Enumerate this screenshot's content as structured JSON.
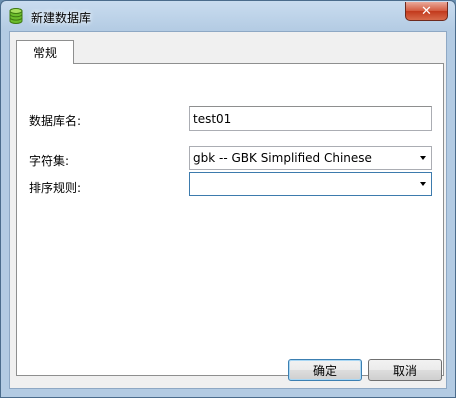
{
  "window": {
    "title": "新建数据库",
    "close_label": "✕"
  },
  "tabs": [
    {
      "label": "常规"
    }
  ],
  "form": {
    "db_name_label": "数据库名:",
    "db_name_value": "test01",
    "charset_label": "字符集:",
    "charset_value": "gbk -- GBK Simplified Chinese",
    "collation_label": "排序规则:",
    "collation_value": ""
  },
  "buttons": {
    "ok": "确定",
    "cancel": "取消"
  },
  "icons": {
    "app": "database-icon",
    "close": "close-icon",
    "dropdown": "chevron-down-icon"
  },
  "colors": {
    "title_bg": "#b3cbe3",
    "close_bg": "#c2391c",
    "focus_border": "#3d7bad"
  }
}
